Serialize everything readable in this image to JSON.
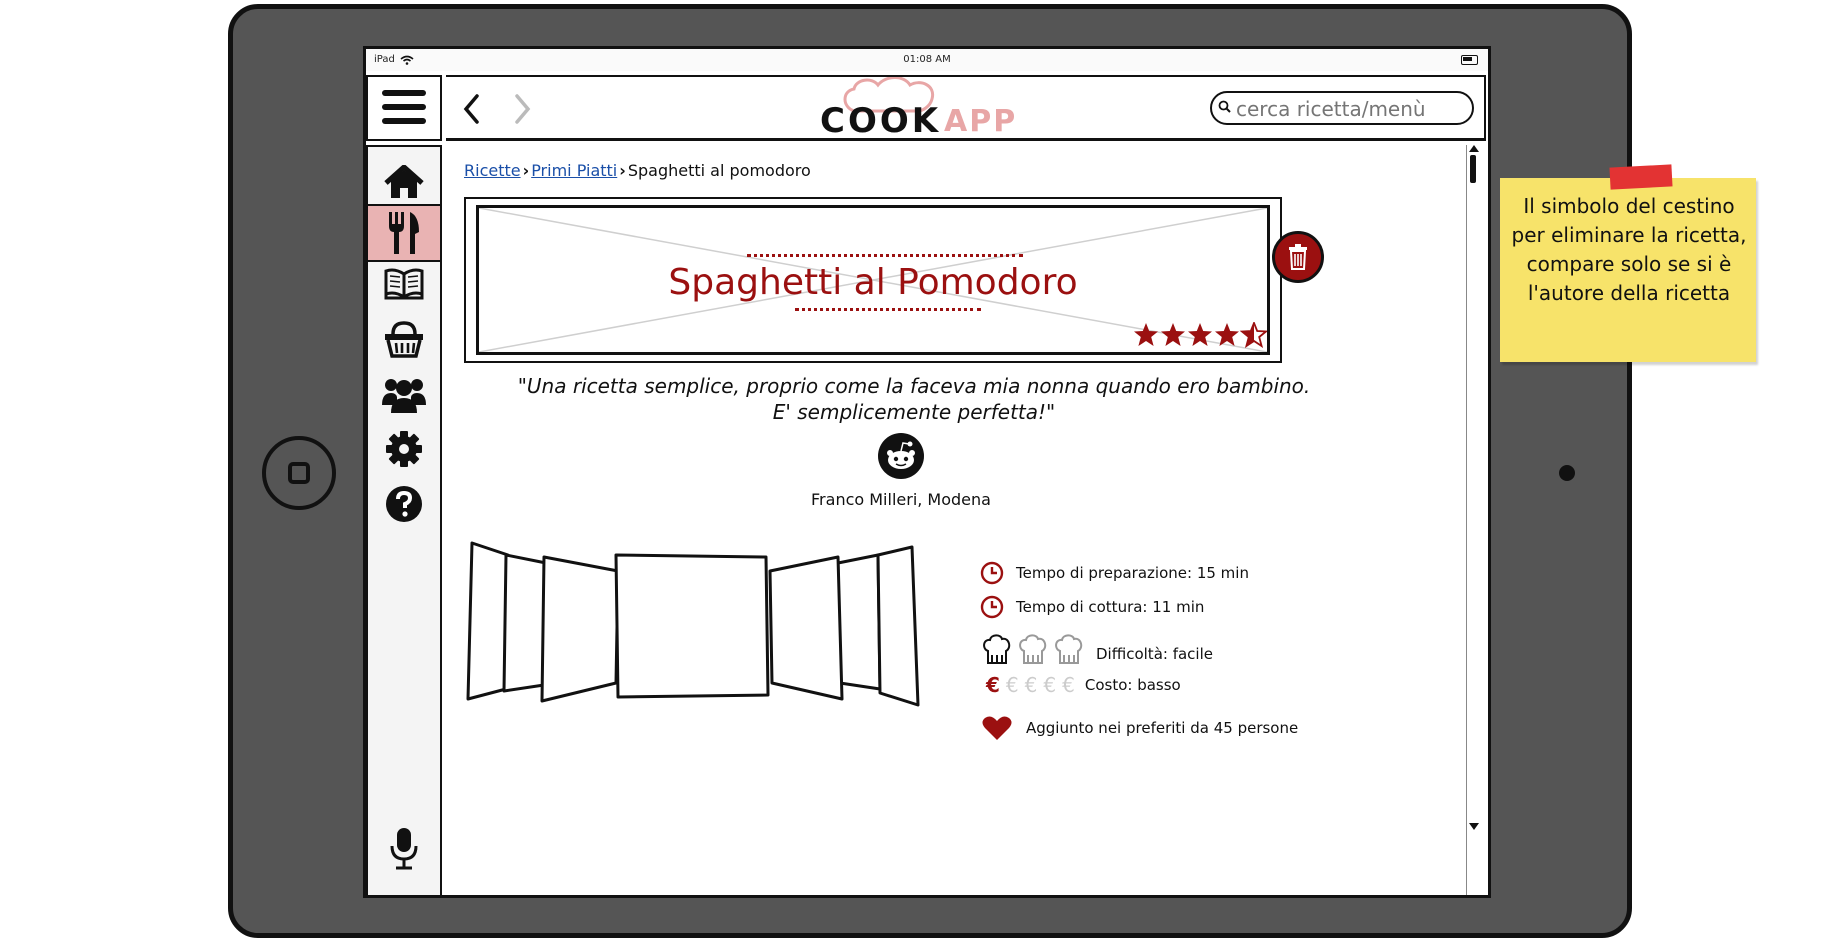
{
  "status_bar": {
    "carrier": "iPad",
    "time": "01:08 AM"
  },
  "header": {
    "logo": {
      "part1": "COOK",
      "part2": "APP"
    },
    "search": {
      "placeholder": "cerca ricetta/menù"
    },
    "back_glyph": "‹",
    "forward_glyph": "›"
  },
  "sidebar": {
    "items": [
      {
        "name": "home-icon",
        "active": false
      },
      {
        "name": "recipes-icon",
        "active": true
      },
      {
        "name": "book-icon",
        "active": false
      },
      {
        "name": "basket-icon",
        "active": false
      },
      {
        "name": "people-icon",
        "active": false
      },
      {
        "name": "gear-icon",
        "active": false
      },
      {
        "name": "help-icon",
        "active": false
      }
    ],
    "bottom": "microphone-icon"
  },
  "breadcrumb": {
    "items": [
      "Ricette",
      "Primi Piatti",
      "Spaghetti al pomodoro"
    ],
    "sep": "›"
  },
  "recipe": {
    "title": "Spaghetti al Pomodoro",
    "rating": 4.5,
    "rating_max": 5,
    "quote_line1": "\"Una ricetta semplice, proprio come la faceva mia nonna quando ero bambino.",
    "quote_line2": "E' semplicemente perfetta!\"",
    "author": "Franco Milleri, Modena"
  },
  "info": {
    "prep_time": "Tempo di preparazione: 15 min",
    "cook_time": "Tempo di cottura: 11 min",
    "difficulty": "Difficoltà: facile",
    "difficulty_level": 1,
    "difficulty_max": 3,
    "cost": "Costo: basso",
    "cost_level": 1,
    "cost_max": 5,
    "cost_symbol": "€",
    "favorites": "Aggiunto nei preferiti da 45 persone"
  },
  "note": {
    "text": "Il simbolo del cestino per eliminare la ricetta, compare solo se si è l'autore della ricetta"
  },
  "colors": {
    "accent": "#9b1010",
    "active_bg": "#e9b3b3",
    "note_bg": "#f7e36a",
    "tablet": "#555555"
  }
}
